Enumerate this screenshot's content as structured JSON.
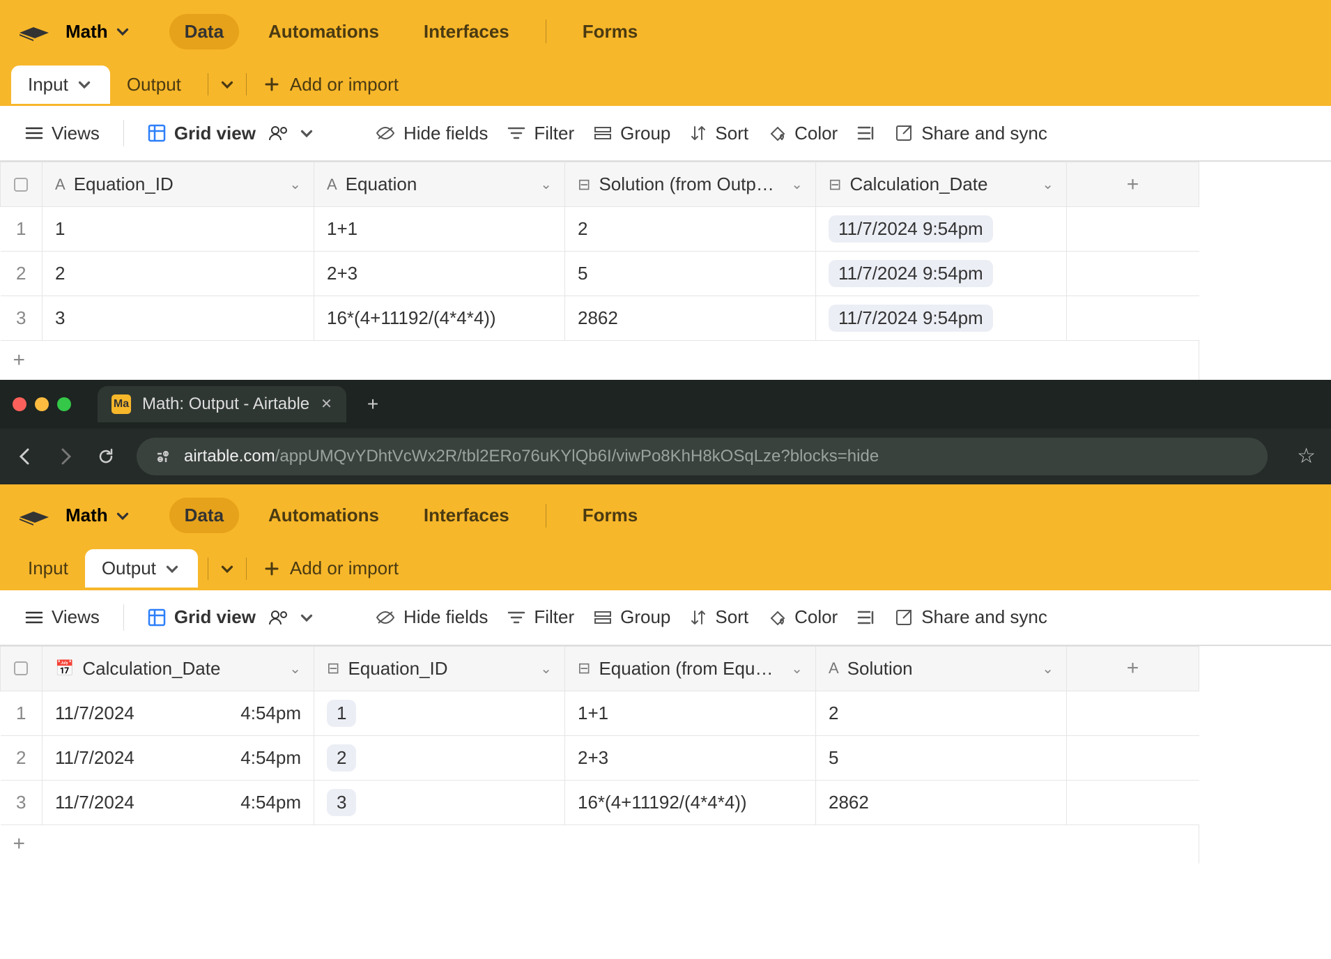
{
  "base_name": "Math",
  "nav": {
    "data": "Data",
    "automations": "Automations",
    "interfaces": "Interfaces",
    "forms": "Forms"
  },
  "tabs_top": {
    "input": "Input",
    "output": "Output",
    "add": "Add or import"
  },
  "toolbar": {
    "views": "Views",
    "grid_view": "Grid view",
    "hide": "Hide fields",
    "filter": "Filter",
    "group": "Group",
    "sort": "Sort",
    "color": "Color",
    "share": "Share and sync"
  },
  "window1": {
    "headers": {
      "c1": "Equation_ID",
      "c2": "Equation",
      "c3": "Solution (from Outp…",
      "c4": "Calculation_Date"
    },
    "rows": [
      {
        "n": "1",
        "id": "1",
        "eq": "1+1",
        "sol": "2",
        "date": "11/7/2024 9:54pm"
      },
      {
        "n": "2",
        "id": "2",
        "eq": "2+3",
        "sol": "5",
        "date": "11/7/2024 9:54pm"
      },
      {
        "n": "3",
        "id": "3",
        "eq": "16*(4+11192/(4*4*4))",
        "sol": "2862",
        "date": "11/7/2024 9:54pm"
      }
    ]
  },
  "browser": {
    "tab_title": "Math: Output - Airtable",
    "host": "airtable.com",
    "path": "/appUMQvYDhtVcWx2R/tbl2ERo76uKYlQb6I/viwPo8KhH8kOSqLze?blocks=hide",
    "favicon": "Ma"
  },
  "window2": {
    "headers": {
      "c1": "Calculation_Date",
      "c2": "Equation_ID",
      "c3": "Equation (from Equ…",
      "c4": "Solution"
    },
    "rows": [
      {
        "n": "1",
        "date": "11/7/2024",
        "time": "4:54pm",
        "id": "1",
        "eq": "1+1",
        "sol": "2"
      },
      {
        "n": "2",
        "date": "11/7/2024",
        "time": "4:54pm",
        "id": "2",
        "eq": "2+3",
        "sol": "5"
      },
      {
        "n": "3",
        "date": "11/7/2024",
        "time": "4:54pm",
        "id": "3",
        "eq": "16*(4+11192/(4*4*4))",
        "sol": "2862"
      }
    ]
  },
  "plus": "+",
  "x": "✕"
}
